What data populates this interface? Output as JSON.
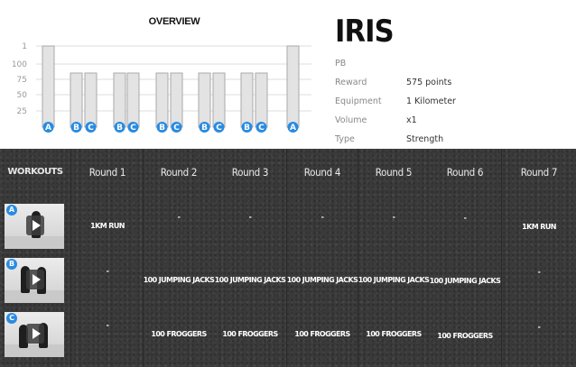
{
  "overview": {
    "title": "OVERVIEW"
  },
  "chart_data": {
    "type": "bar",
    "categories": [
      "A",
      "B",
      "C",
      "B",
      "C",
      "B",
      "C",
      "B",
      "C",
      "B",
      "C",
      "A"
    ],
    "values": [
      1,
      100,
      100,
      100,
      100,
      100,
      100,
      100,
      100,
      100,
      100,
      1
    ],
    "y_tick_labels": [
      "1",
      "100",
      "75",
      "50",
      "25"
    ],
    "grid": true,
    "colors": {
      "bar": "#e3e3e3",
      "badge": "#2a8be0"
    }
  },
  "workout": {
    "name": "IRIS",
    "info": [
      {
        "label": "PB",
        "value": ""
      },
      {
        "label": "Reward",
        "value": "575 points"
      },
      {
        "label": "Equipment",
        "value": "1 Kilometer"
      },
      {
        "label": "Volume",
        "value": "x1"
      },
      {
        "label": "Type",
        "value": "Strength"
      }
    ]
  },
  "grid": {
    "workouts_label": "WORKOUTS",
    "rounds": [
      "Round 1",
      "Round 2",
      "Round 3",
      "Round 4",
      "Round 5",
      "Round 6",
      "Round 7"
    ],
    "rows": [
      {
        "badge": "A",
        "cells": [
          "1KM RUN",
          "-",
          "-",
          "-",
          "-",
          "-",
          "1KM RUN"
        ]
      },
      {
        "badge": "B",
        "cells": [
          "-",
          "100 JUMPING JACKS",
          "100 JUMPING JACKS",
          "100 JUMPING JACKS",
          "100 JUMPING JACKS",
          "100 JUMPING JACKS",
          "-"
        ]
      },
      {
        "badge": "C",
        "cells": [
          "-",
          "100 FROGGERS",
          "100 FROGGERS",
          "100 FROGGERS",
          "100 FROGGERS",
          "100 FROGGERS",
          "-"
        ]
      }
    ]
  }
}
